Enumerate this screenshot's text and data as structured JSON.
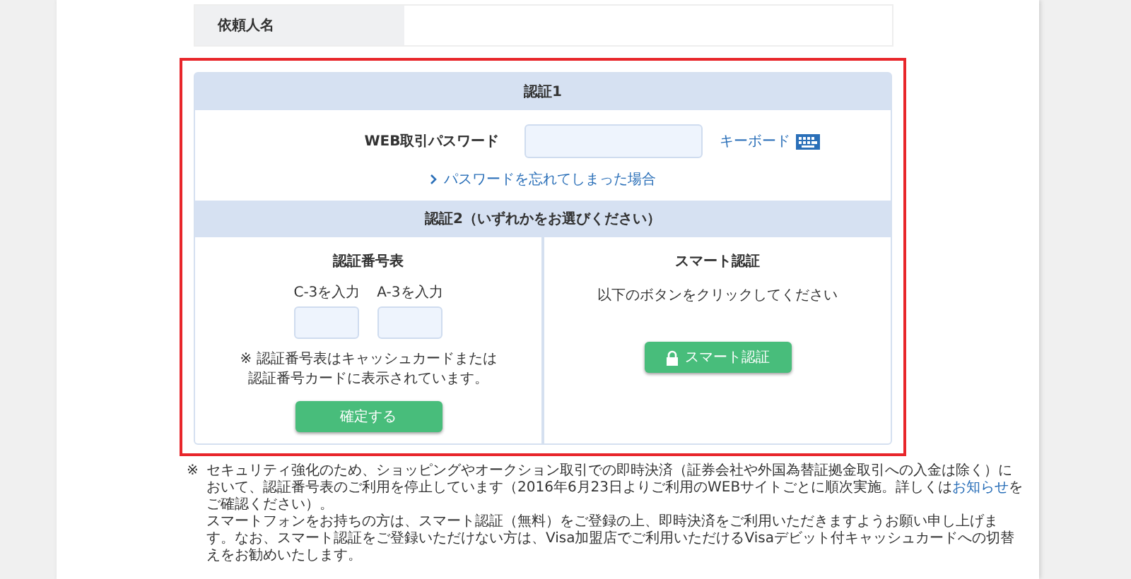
{
  "requester": {
    "label": "依頼人名"
  },
  "auth1": {
    "title": "認証1",
    "password_label": "WEB取引パスワード",
    "keyboard_link": "キーボード",
    "forgot_link": "パスワードを忘れてしまった場合"
  },
  "auth2": {
    "title": "認証2（いずれかをお選びください）",
    "number_table": {
      "title": "認証番号表",
      "inputs": [
        {
          "label": "C-3を入力"
        },
        {
          "label": "A-3を入力"
        }
      ],
      "note_lines": [
        "※ 認証番号表はキャッシュカードまたは",
        "認証番号カードに表示されています。"
      ],
      "button": "確定する"
    },
    "smart": {
      "title": "スマート認証",
      "instruction": "以下のボタンをクリックしてください",
      "button": "スマート認証"
    }
  },
  "notice": {
    "mark": "※",
    "before": "セキュリティ強化のため、ショッピングやオークション取引での即時決済（証券会社や外国為替証拠金取引への入金は除く）において、認証番号表のご利用を停止しています（2016年6月23日よりご利用のWEBサイトごとに順次実施。詳しくは",
    "link": "お知らせ",
    "after": "をご確認ください）。",
    "second": "スマートフォンをお持ちの方は、スマート認証（無料）をご登録の上、即時決済をご利用いただきますようお願い申し上げます。なお、スマート認証をご登録いただけない方は、Visa加盟店でご利用いただけるVisaデビット付キャッシュカードへの切替えをお勧めいたします。"
  }
}
